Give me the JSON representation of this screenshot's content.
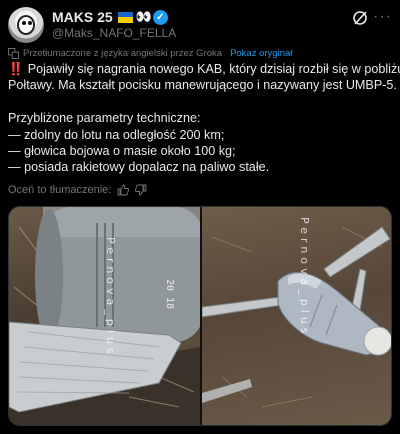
{
  "author": {
    "display_name": "MAKS 25",
    "emoji_eyes": "👀",
    "handle": "@Maks_NAFO_FELLA"
  },
  "icons": {
    "avatar": "avatar",
    "flag": "ukraine-flag-icon",
    "verified": "verified-badge-icon",
    "grok": "grok-icon",
    "more": "more-icon",
    "translate": "translate-icon",
    "thumbs_up": "thumbs-up-icon",
    "thumbs_down": "thumbs-down-icon"
  },
  "translation": {
    "notice": "Przetłumaczone z języka angielski przez Groka",
    "show_original": "Pokaż oryginał"
  },
  "post": {
    "emoji": "‼️",
    "line1": "Pojawiły się nagrania nowego KAB, który dzisiaj rozbił się w pobliżu",
    "line2": "Połtawy. Ma kształt pocisku manewrującego i nazywany jest UMBP-5.",
    "line3": "Przybliżone parametry techniczne:",
    "line4": "— zdolny do lotu na odległość 200 km;",
    "line5": "— głowica bojowa o masie około 100 kg;",
    "line6": "— posiada rakietowy dopalacz na paliwo stałe."
  },
  "rate_translation": "Oceń to tłumaczenie:",
  "media": {
    "left_watermark": "Pernova_plus",
    "left_marking": "20 18",
    "right_watermark": "Pernova_plus"
  },
  "colors": {
    "background": "#000000",
    "text": "#e7e9ea",
    "secondary": "#71767b",
    "link": "#1d9bf0",
    "verified": "#1d9bf0",
    "alert": "#e0245e"
  }
}
